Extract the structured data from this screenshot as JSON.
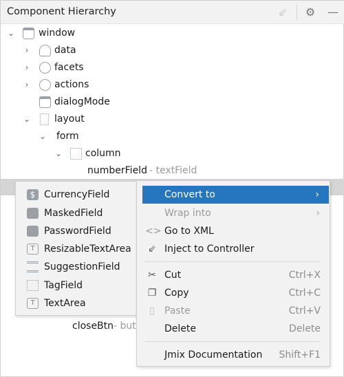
{
  "header": {
    "title": "Component Hierarchy",
    "icons": [
      "inject-icon",
      "gear-icon",
      "minimize-icon"
    ]
  },
  "tree": [
    {
      "label": "window",
      "type": "",
      "expanded": true
    },
    {
      "label": "data",
      "type": ""
    },
    {
      "label": "facets",
      "type": ""
    },
    {
      "label": "actions",
      "type": ""
    },
    {
      "label": "dialogMode",
      "type": ""
    },
    {
      "label": "layout",
      "type": "",
      "expanded": true
    },
    {
      "label": "form",
      "type": "",
      "expanded": true
    },
    {
      "label": "column",
      "type": "",
      "expanded": true
    },
    {
      "label": "numberField",
      "type": "- textField"
    },
    {
      "label": "closeBtn",
      "type": "- but"
    }
  ],
  "context_menu": {
    "items": [
      {
        "label": "Convert to",
        "shortcut": "",
        "state": "highlighted",
        "icon": ""
      },
      {
        "label": "Wrap into",
        "shortcut": "",
        "state": "disabled",
        "icon": ""
      },
      {
        "label": "Go to XML",
        "shortcut": "",
        "icon": "code-brackets-icon"
      },
      {
        "label": "Inject to Controller",
        "shortcut": "",
        "icon": "inject-icon"
      },
      {
        "label": "Cut",
        "shortcut": "Ctrl+X",
        "icon": "scissors-icon"
      },
      {
        "label": "Copy",
        "shortcut": "Ctrl+C",
        "icon": "copy-icon"
      },
      {
        "label": "Paste",
        "shortcut": "Ctrl+V",
        "state": "disabled",
        "icon": "paste-icon"
      },
      {
        "label": "Delete",
        "shortcut": "Delete",
        "icon": ""
      },
      {
        "label": "Jmix Documentation",
        "shortcut": "Shift+F1",
        "icon": ""
      }
    ]
  },
  "convert_submenu": {
    "items": [
      "CurrencyField",
      "MaskedField",
      "PasswordField",
      "ResizableTextArea",
      "SuggestionField",
      "TagField",
      "TextArea"
    ]
  },
  "colors": {
    "highlight": "#2675bf",
    "menu_bg": "#f2f2f2",
    "selection": "#d5d5d5"
  }
}
